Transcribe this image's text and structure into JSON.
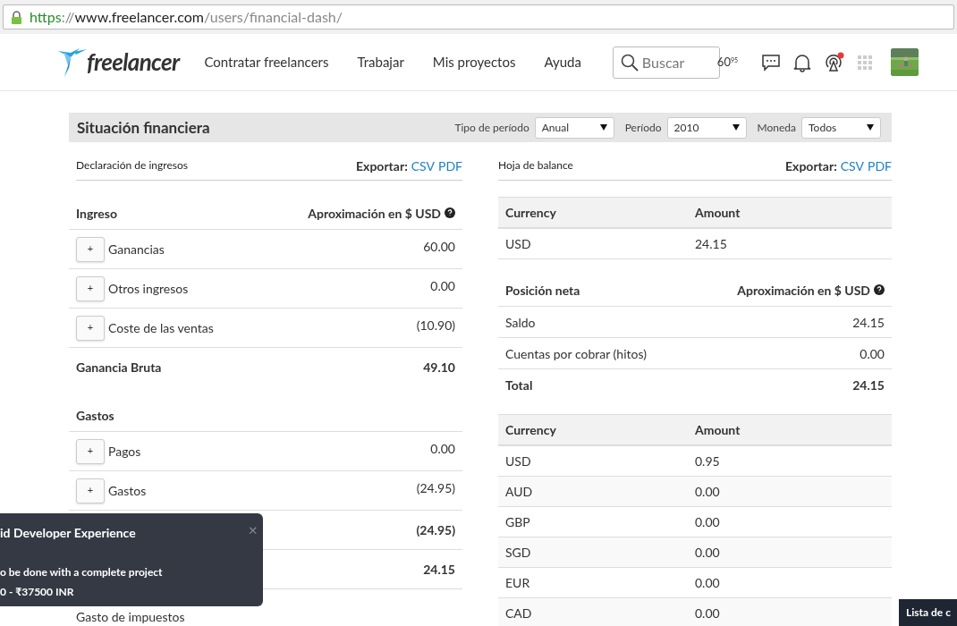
{
  "browser": {
    "url_parts": [
      {
        "kind": "scheme",
        "text": "https"
      },
      {
        "kind": "sep",
        "text": "://"
      },
      {
        "kind": "host",
        "text": "www.freelancer.com"
      },
      {
        "kind": "path",
        "text": "/users/financial-dash/"
      }
    ]
  },
  "nav": {
    "logo": "freelancer",
    "links": [
      "Contratar freelancers",
      "Trabajar",
      "Mis proyectos",
      "Ayuda"
    ],
    "search": {
      "placeholder": "Buscar"
    },
    "balance": "60",
    "balance_cents": "95",
    "broadcast_unread": true
  },
  "header": {
    "title": "Situación financiera",
    "filters": [
      {
        "label": "Tipo de período",
        "value": "Anual"
      },
      {
        "label": "Período",
        "value": "2010"
      },
      {
        "label": "Moneda",
        "value": "Todos"
      }
    ]
  },
  "income": {
    "title": "Declaración de ingresos",
    "export_label": "Exportar:",
    "export_links": [
      "CSV",
      "PDF"
    ],
    "sections": [
      {
        "heading": "Ingreso",
        "column": "Aproximación en $ USD",
        "rows": [
          {
            "kind": "expandable",
            "expand": "+",
            "label": "Ganancias",
            "value": "60.00"
          },
          {
            "kind": "expandable",
            "expand": "+",
            "label": "Otros ingresos",
            "value": "0.00"
          },
          {
            "kind": "expandable",
            "expand": "+",
            "label": "Coste de las ventas",
            "value": "(10.90)"
          },
          {
            "kind": "total",
            "label": "Ganancia Bruta",
            "value": "49.10"
          }
        ]
      },
      {
        "heading": "Gastos",
        "rows": [
          {
            "kind": "expandable",
            "expand": "+",
            "label": "Pagos",
            "value": "0.00"
          },
          {
            "kind": "expandable",
            "expand": "+",
            "label": "Gastos",
            "value": "(24.95)"
          },
          {
            "kind": "total",
            "value": "(24.95)"
          },
          {
            "kind": "total",
            "value": "24.15"
          },
          {
            "kind": "plain",
            "label": "Gasto de impuestos"
          }
        ]
      }
    ]
  },
  "balance": {
    "title": "Hoja de balance",
    "export_label": "Exportar:",
    "export_links": [
      "CSV",
      "PDF"
    ],
    "table1": {
      "columns": [
        "Currency",
        "Amount"
      ],
      "rows": [
        [
          "USD",
          "24.15"
        ]
      ]
    },
    "net": {
      "heading": "Posición neta",
      "column": "Aproximación en $ USD",
      "rows": [
        {
          "kind": "plain",
          "label": "Saldo",
          "value": "24.15"
        },
        {
          "kind": "plain",
          "label": "Cuentas por cobrar (hitos)",
          "value": "0.00"
        },
        {
          "kind": "total",
          "label": "Total",
          "value": "24.15"
        }
      ]
    },
    "table2": {
      "columns": [
        "Currency",
        "Amount"
      ],
      "rows": [
        [
          "USD",
          "0.95"
        ],
        [
          "AUD",
          "0.00"
        ],
        [
          "GBP",
          "0.00"
        ],
        [
          "SGD",
          "0.00"
        ],
        [
          "EUR",
          "0.00"
        ],
        [
          "CAD",
          "0.00"
        ]
      ]
    }
  },
  "toast": {
    "title": "id Developer Experience",
    "close": "×",
    "lines": [
      "o be done with a complete project",
      "0 - ₹37500 INR"
    ]
  },
  "corner_tab": "Lista de c"
}
